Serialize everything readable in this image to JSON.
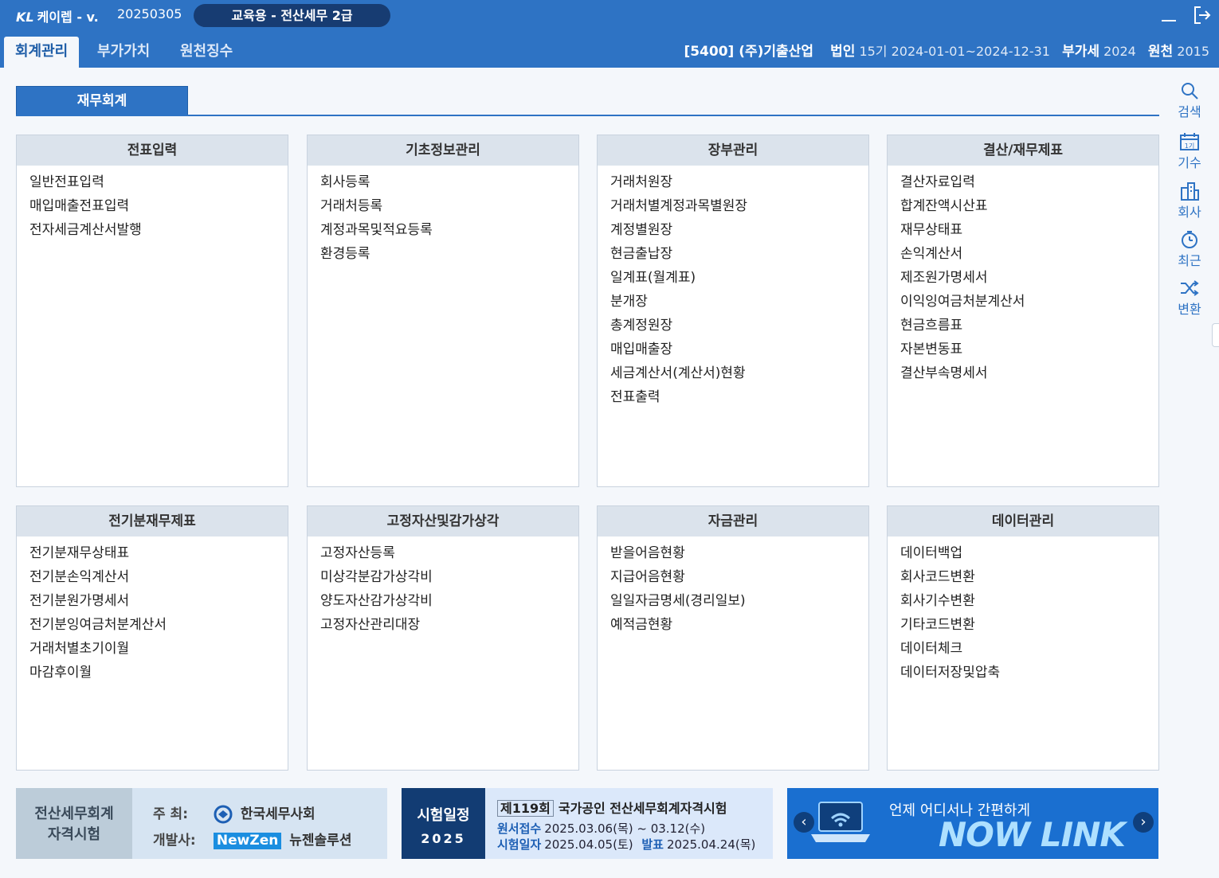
{
  "app": {
    "logo_mark": "KL",
    "logo_text": "케이렙 - v.",
    "version": "20250305",
    "edition": "교육용 - 전산세무 2급"
  },
  "menu": {
    "tabs": [
      "회계관리",
      "부가가치",
      "원천징수"
    ],
    "active": "회계관리"
  },
  "company": {
    "code_name": "[5400] (주)기출산업",
    "type_label": "법인",
    "period": "15기 2024-01-01~2024-12-31",
    "vat_label": "부가세",
    "vat_year": "2024",
    "withholding_label": "원천",
    "withholding_year": "2015"
  },
  "section_tab": "재무회계",
  "panels": [
    {
      "title": "전표입력",
      "items": [
        "일반전표입력",
        "매입매출전표입력",
        "전자세금계산서발행"
      ]
    },
    {
      "title": "기초정보관리",
      "items": [
        "회사등록",
        "거래처등록",
        "계정과목및적요등록",
        "환경등록"
      ]
    },
    {
      "title": "장부관리",
      "items": [
        "거래처원장",
        "거래처별계정과목별원장",
        "계정별원장",
        "현금출납장",
        "일계표(월계표)",
        "분개장",
        "총계정원장",
        "매입매출장",
        "세금계산서(계산서)현황",
        "전표출력"
      ]
    },
    {
      "title": "결산/재무제표",
      "items": [
        "결산자료입력",
        "합계잔액시산표",
        "재무상태표",
        "손익계산서",
        "제조원가명세서",
        "이익잉여금처분계산서",
        "현금흐름표",
        "자본변동표",
        "결산부속명세서"
      ]
    },
    {
      "title": "전기분재무제표",
      "items": [
        "전기분재무상태표",
        "전기분손익계산서",
        "전기분원가명세서",
        "전기분잉여금처분계산서",
        "거래처별초기이월",
        "마감후이월"
      ]
    },
    {
      "title": "고정자산및감가상각",
      "items": [
        "고정자산등록",
        "미상각분감가상각비",
        "양도자산감가상각비",
        "고정자산관리대장"
      ]
    },
    {
      "title": "자금관리",
      "items": [
        "받을어음현황",
        "지급어음현황",
        "일일자금명세(경리일보)",
        "예적금현황"
      ]
    },
    {
      "title": "데이터관리",
      "items": [
        "데이터백업",
        "회사코드변환",
        "회사기수변환",
        "기타코드변환",
        "데이터체크",
        "데이터저장및압축"
      ]
    }
  ],
  "sidebar": [
    {
      "label": "검색",
      "icon": "search-icon"
    },
    {
      "label": "기수",
      "icon": "calendar-icon"
    },
    {
      "label": "회사",
      "icon": "building-icon"
    },
    {
      "label": "최근",
      "icon": "clock-icon"
    },
    {
      "label": "변환",
      "icon": "shuffle-icon"
    }
  ],
  "calendar_icon_text": "1기",
  "banners": {
    "exam": {
      "title_line1": "전산세무회계",
      "title_line2": "자격시험",
      "host_label": "주 최:",
      "host": "한국세무사회",
      "dev_label": "개발사:",
      "dev_badge": "NewZen",
      "dev": "뉴젠솔루션"
    },
    "schedule": {
      "label_line1": "시험일정",
      "label_line2": "2025",
      "round": "제119회",
      "exam_name": "국가공인 전산세무회계자격시험",
      "apply_label": "원서접수",
      "apply_dates": "2025.03.06(목) ~ 03.12(수)",
      "exam_label": "시험일자",
      "exam_date": "2025.04.05(토)",
      "result_label": "발표",
      "result_date": "2025.04.24(목)"
    },
    "nowlink": {
      "tagline": "언제 어디서나 간편하게",
      "brand": "NOW LINK"
    }
  },
  "colors": {
    "primary": "#2e73c4",
    "dark_pill": "#173c72",
    "panel_header": "#dbe3ec",
    "background": "#f4f7fb"
  }
}
